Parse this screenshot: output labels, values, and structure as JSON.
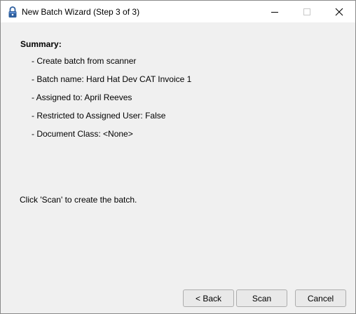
{
  "window": {
    "title": "New Batch Wizard (Step 3 of 3)",
    "icon": "padlock-icon"
  },
  "summary": {
    "heading": "Summary:",
    "lines": [
      "- Create batch from scanner",
      "- Batch name: Hard Hat Dev CAT Invoice 1",
      "- Assigned to: April  Reeves",
      "- Restricted to Assigned User: False",
      "- Document Class: <None>"
    ]
  },
  "instruction": "Click 'Scan' to create the batch.",
  "buttons": {
    "back": "< Back",
    "scan": "Scan",
    "cancel": "Cancel"
  },
  "colors": {
    "titlebar": "#ffffff",
    "dialog_background": "#f0f0f0",
    "icon_blue": "#2e5f9e"
  }
}
